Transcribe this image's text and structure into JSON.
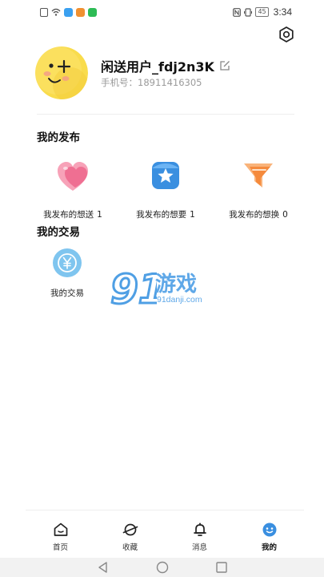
{
  "status_bar": {
    "battery": "45",
    "time": "3:34",
    "app_colors": [
      "#3aa0f0",
      "#f09030",
      "#2dbb55"
    ]
  },
  "profile": {
    "username": "闲送用户_fdj2n3K",
    "phone": "手机号：18911416305"
  },
  "publish_section": {
    "title": "我的发布",
    "items": [
      {
        "label": "我发布的想送",
        "count": "1",
        "icon": "hearts-icon"
      },
      {
        "label": "我发布的想要",
        "count": "1",
        "icon": "star-ticket-icon"
      },
      {
        "label": "我发布的想换",
        "count": "0",
        "icon": "exchange-funnel-icon"
      }
    ]
  },
  "trade_section": {
    "title": "我的交易",
    "item_label": "我的交易",
    "icon": "yen-coin-icon"
  },
  "watermark": {
    "big": "游戏",
    "small": "91danji.com",
    "logo": "91"
  },
  "bottom_nav": {
    "items": [
      {
        "label": "首页",
        "icon": "home-icon"
      },
      {
        "label": "收藏",
        "icon": "planet-icon"
      },
      {
        "label": "消息",
        "icon": "bell-icon"
      },
      {
        "label": "我的",
        "icon": "smile-face-icon",
        "active": true
      }
    ]
  },
  "colors": {
    "accent_blue": "#3a8fe0",
    "avatar_yellow": "#f8dc4a",
    "pink": "#f27a9c",
    "orange": "#f79a4c",
    "muted_text": "#9a9a9a"
  }
}
